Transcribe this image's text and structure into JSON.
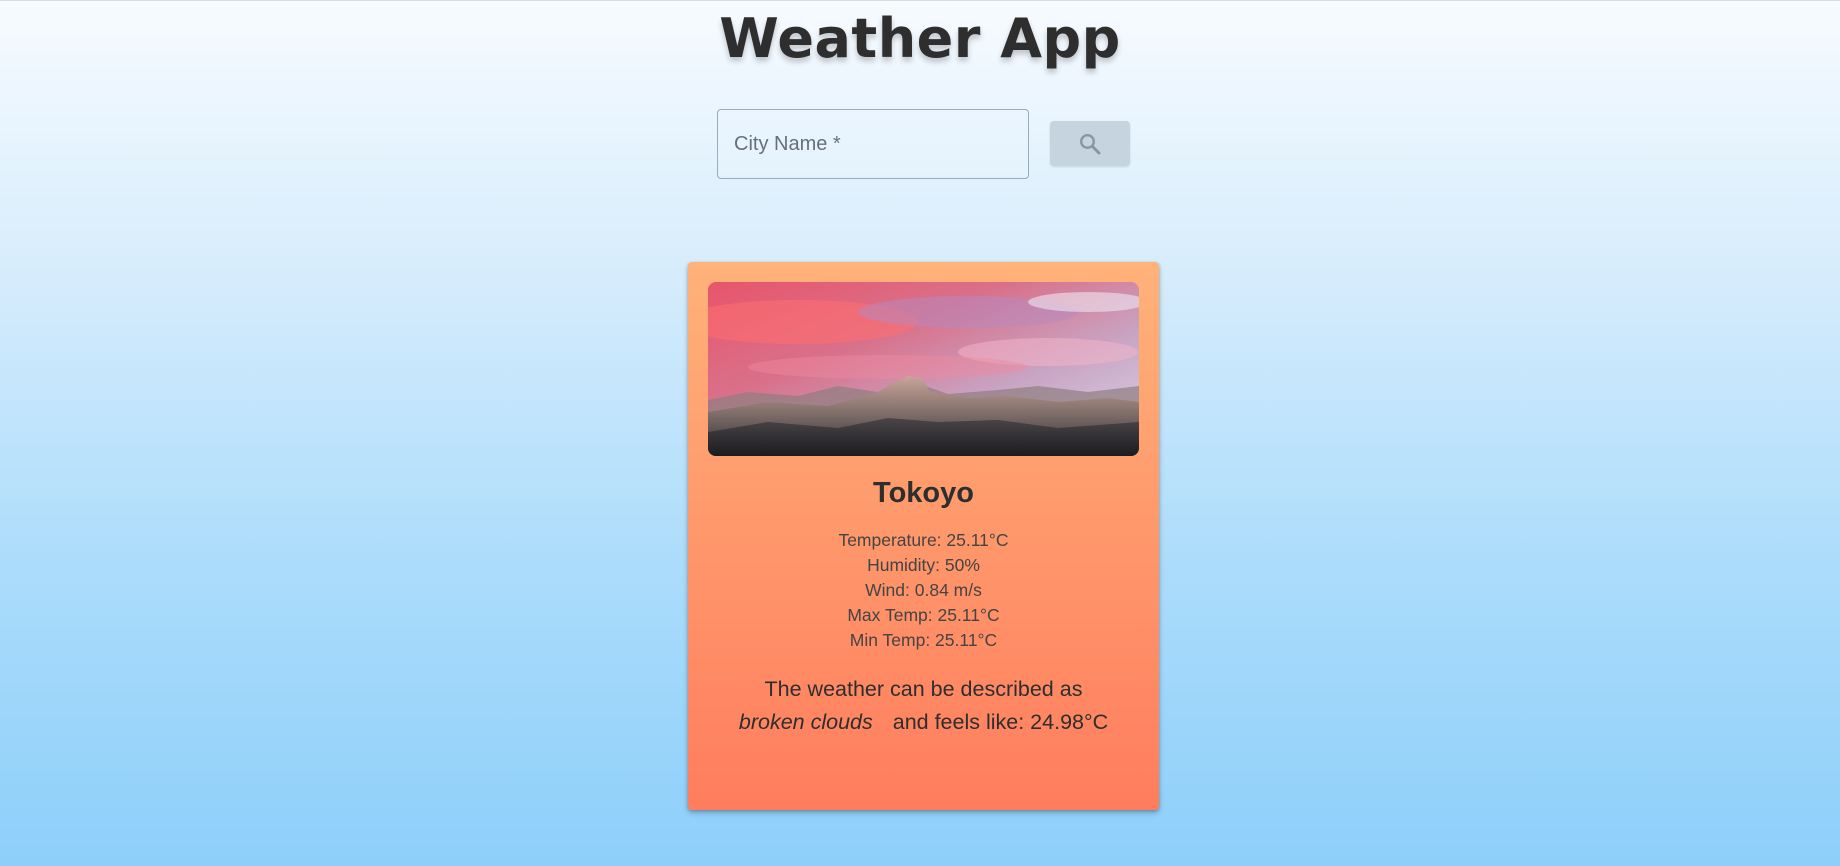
{
  "header": {
    "title": "Weather App"
  },
  "search": {
    "placeholder": "City Name *",
    "value": "",
    "button_icon": "search-icon"
  },
  "card": {
    "image": "landscape-photo",
    "city": "Tokoyo",
    "stats": [
      "Temperature: 25.11°C",
      "Humidity: 50%",
      "Wind: 0.84 m/s",
      "Max Temp: 25.11°C",
      "Min Temp: 25.11°C"
    ],
    "description_prefix": "The weather can be described as",
    "condition": "broken clouds",
    "feels_like": "and feels like: 24.98°C"
  },
  "colors": {
    "background_top": "#f7fbff",
    "background_bottom": "#8dcffa",
    "card_top": "#ffb27a",
    "card_bottom": "#ff7d5e",
    "button_bg": "#c6d4df",
    "title_text": "#2e2e2e"
  }
}
